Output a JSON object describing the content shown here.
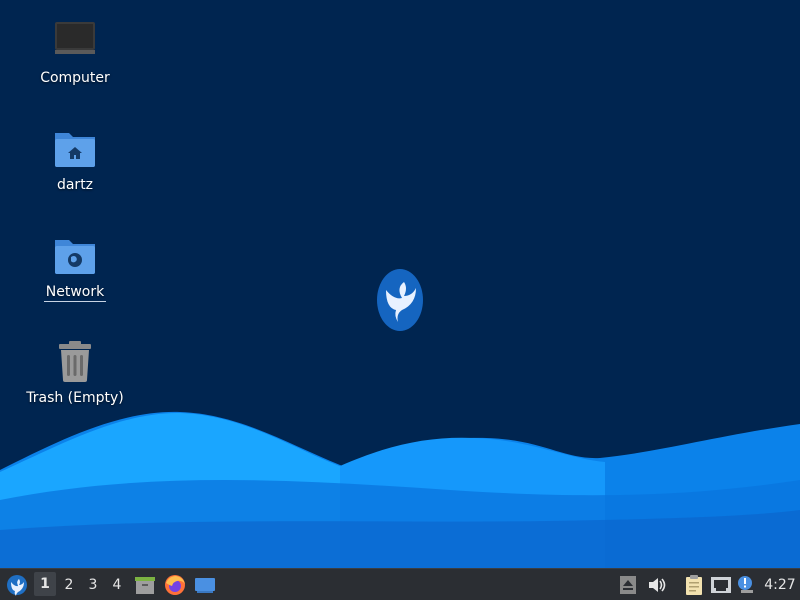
{
  "desktop": {
    "background_color": "#002550",
    "wave_colors": [
      "#0b7fe6",
      "#1aa3ff",
      "#0d8df4",
      "#0a6fd8"
    ],
    "icons": [
      {
        "name": "computer",
        "label": "Computer"
      },
      {
        "name": "home-folder",
        "label": "dartz"
      },
      {
        "name": "network-folder",
        "label": "Network"
      },
      {
        "name": "trash",
        "label": "Trash (Empty)"
      }
    ]
  },
  "taskbar": {
    "background_color": "#2b2e33",
    "menu_icon": "whisker-menu-bird-icon",
    "workspaces": [
      "1",
      "2",
      "3",
      "4"
    ],
    "active_workspace": "1",
    "launchers": [
      "file-manager-icon",
      "firefox-icon",
      "show-desktop-icon"
    ],
    "tray_icons": [
      "eject-icon",
      "volume-icon",
      "clipboard-icon",
      "network-wired-icon",
      "notification-icon"
    ],
    "clock": "4:27"
  }
}
